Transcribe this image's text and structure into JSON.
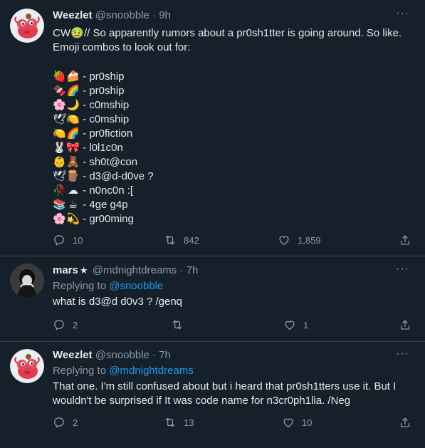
{
  "tweets": [
    {
      "name": "Weezlet",
      "handle": "@snoobble",
      "dot": "·",
      "time": "9h",
      "more": "···",
      "text_cw": "CW",
      "text_cw_emoji": "🤢",
      "text_intro": "// So apparently rumors about a pr0sh1tter is going around. So like. Emoji combos to look out for:",
      "emoji_rows": [
        {
          "emoji": [
            "🍓",
            "🍰"
          ],
          "label": " - pr0ship"
        },
        {
          "emoji": [
            "🍫",
            "🌈"
          ],
          "label": " - pr0ship"
        },
        {
          "emoji": [
            "🌸",
            "🌙"
          ],
          "label": " - c0mship"
        },
        {
          "emoji": [
            "🕊",
            "🍋"
          ],
          "label": " - c0mship"
        },
        {
          "emoji": [
            "🍋",
            "🌈"
          ],
          "label": " - pr0fiction"
        },
        {
          "emoji": [
            "🐰",
            "🎀"
          ],
          "label": " - l0l1c0n"
        },
        {
          "emoji": [
            "👶",
            "🧸"
          ],
          "label": " - sh0t@con"
        },
        {
          "emoji": [
            "🕊",
            "🪵"
          ],
          "label": " - d3@d-d0ve ?"
        },
        {
          "emoji": [
            "🥀",
            "☁"
          ],
          "label": " - n0nc0n :["
        },
        {
          "emoji": [
            "📚",
            "☕"
          ],
          "label": " - 4ge g4p"
        },
        {
          "emoji": [
            "🌸",
            "💫"
          ],
          "label": " - gr00ming"
        }
      ],
      "replies": "10",
      "retweets": "842",
      "likes": "1,859"
    },
    {
      "name": "mars",
      "badge": "★",
      "handle": "@mdnightdreams",
      "dot": "·",
      "time": "7h",
      "more": "···",
      "replying_label": "Replying to",
      "replying_handle": "@snoobble",
      "text": "what is d3@d d0v3 ? /genq",
      "replies": "2",
      "retweets": "",
      "likes": "1"
    },
    {
      "name": "Weezlet",
      "handle": "@snoobble",
      "dot": "·",
      "time": "7h",
      "more": "···",
      "replying_label": "Replying to",
      "replying_handle": "@mdnightdreams",
      "text": "That one. I'm still confused about but i heard that pr0sh1tters use it. But I wouldn't be surprised if It was code name for n3cr0ph1lia. /Neg",
      "replies": "2",
      "retweets": "13",
      "likes": "10"
    }
  ],
  "colors": {
    "background": "#15202b",
    "text": "#e7e9ea",
    "muted": "#8b98a5",
    "accent": "#1d9bf0",
    "divider": "#38444d"
  },
  "icons": [
    "reply-icon",
    "retweet-icon",
    "like-icon",
    "share-icon",
    "more-icon"
  ]
}
